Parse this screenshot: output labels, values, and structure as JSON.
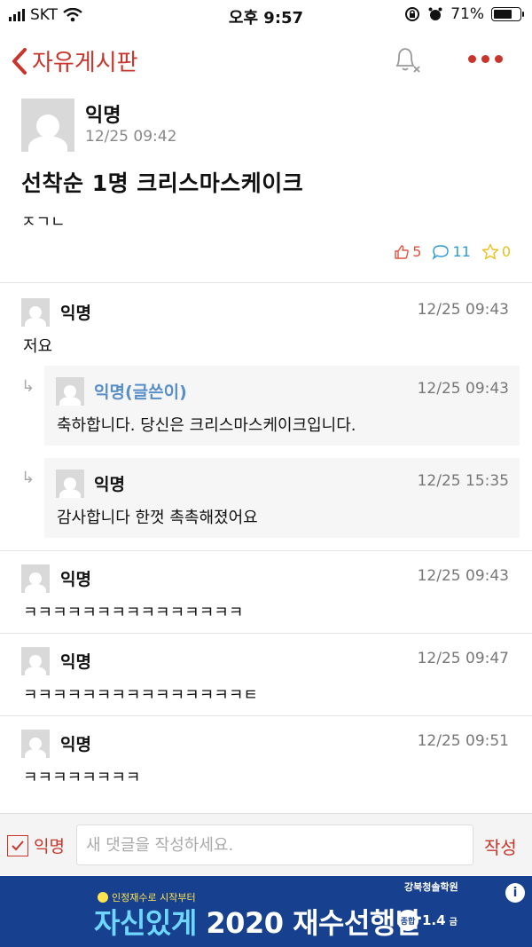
{
  "status_bar": {
    "carrier": "SKT",
    "time": "오후 9:57",
    "battery": "71%",
    "battery_level": 0.71
  },
  "header": {
    "board_title": "자유게시판",
    "icons": [
      "back-chevron-icon",
      "notification-bell-icon",
      "more-dots-icon"
    ]
  },
  "post": {
    "author": "익명",
    "date": "12/25 09:42",
    "title": "선착순 1명 크리스마스케이크",
    "content": "ㅈㄱㄴ",
    "likes": "5",
    "comments": "11",
    "scraps": "0",
    "colors": {
      "likes": "#e0533f",
      "comments": "#2b9ad6",
      "scraps": "#e9c11a"
    }
  },
  "comments": [
    {
      "author": "익명",
      "time": "12/25 09:43",
      "text": "저요",
      "replies": [
        {
          "author": "익명(글쓴이)",
          "time": "12/25 09:43",
          "text": "축하합니다. 당신은 크리스마스케이크입니다."
        },
        {
          "author": "익명",
          "time": "12/25 15:35",
          "text": "감사합니다 한껏 촉촉해졌어요"
        }
      ]
    },
    {
      "author": "익명",
      "time": "12/25 09:43",
      "text": "ㅋㅋㅋㅋㅋㅋㅋㅋㅋㅋㅋㅋㅋㅋㅋ"
    },
    {
      "author": "익명",
      "time": "12/25 09:47",
      "text": "ㅋㅋㅋㅋㅋㅋㅋㅋㅋㅋㅋㅋㅋㅋㅋㅌ"
    },
    {
      "author": "익명",
      "time": "12/25 09:51",
      "text": "ㅋㅋㅋㅋㅋㅋㅋㅋ"
    }
  ],
  "input_bar": {
    "anonymous_label": "익명",
    "anonymous_checked": true,
    "placeholder": "새 댓글을 작성하세요.",
    "submit_label": "작성"
  },
  "ad": {
    "subtitle": "인정재수로 시작부터",
    "brand": "강북청솔학원",
    "headline_accent": "자신있게",
    "headline": "2020 재수선행반",
    "badge_label": "종합",
    "badge_value": "1.4",
    "badge_unit": "금",
    "info_label": "i",
    "accent_color": "#17418f"
  }
}
